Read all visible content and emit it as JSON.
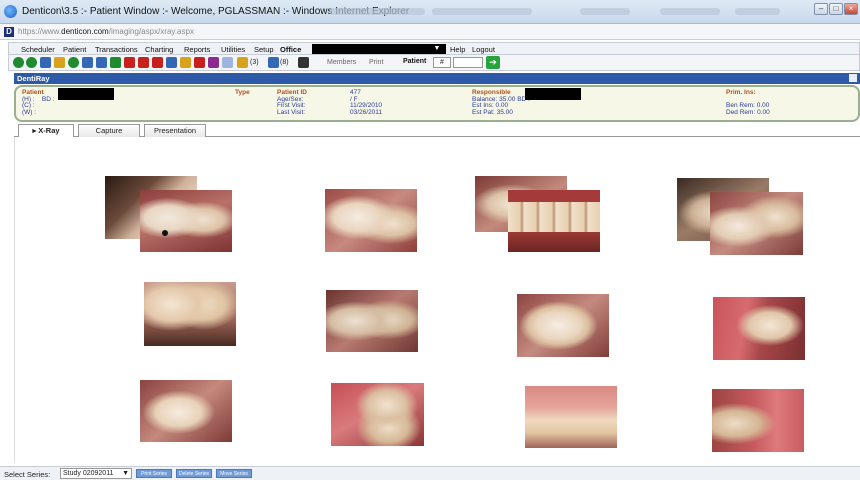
{
  "window": {
    "title": "Denticon\\3.5 :- Patient Window :- Welcome, PGLASSMAN :- Windows Internet Explorer",
    "url_prefix": "https://www.",
    "url_domain": "denticon.com",
    "url_path": "/imaging/aspx/xray.aspx"
  },
  "menu": {
    "items": [
      "Scheduler",
      "Patient",
      "Transactions",
      "Charting",
      "Reports",
      "Utilities",
      "Setup",
      "Office",
      "Help",
      "Logout"
    ]
  },
  "toolbar": {
    "count_a": "(3)",
    "count_b": "(8)",
    "members_label": "Members",
    "print_label": "Print",
    "patient_label": "Patient",
    "patient_select": "#",
    "go_label": "➔"
  },
  "module": {
    "title": "DentiRay"
  },
  "patient": {
    "patient_label": "Patient",
    "h_label": "(H) :",
    "bd_label": "BD :",
    "c_label": "(C) :",
    "w_label": "(W) :",
    "type_label": "Type",
    "patient_id_label": "Patient ID",
    "age_sex_label": "Age/Sex:",
    "first_visit_label": "First Visit:",
    "last_visit_label": "Last Visit:",
    "patient_id": "477",
    "age_sex": "/ F",
    "first_visit": "11/29/2010",
    "last_visit": "03/26/2011",
    "responsible_label": "Responsible",
    "balance_label": "Balance:",
    "balance": "35.00",
    "est_ins_label": "Est Ins:",
    "est_ins": "0.00",
    "est_pat_label": "Est Pat:",
    "est_pat": "35.00",
    "prim_ins_label": "Prim. Ins:",
    "ben_rem_label": "Ben Rem:",
    "ben_rem": "0.00",
    "ded_rem_label": "Ded Rem:",
    "ded_rem": "0.00"
  },
  "tabs": [
    {
      "label": "▸ X-Ray",
      "active": true
    },
    {
      "label": "Capture",
      "active": false
    },
    {
      "label": "Presentation",
      "active": false
    }
  ],
  "status": {
    "select_series_label": "Select Series:",
    "series_value": "Study 02092011",
    "buttons": [
      "Print Series",
      "Delete Series",
      "Move Series"
    ]
  },
  "colors": {
    "module_bar": "#2d5aa8",
    "info_border": "#9aae92",
    "label_orange": "#b0501e",
    "value_blue": "#2a3a9a"
  },
  "photos": [
    {
      "name": "intraoral-photo-1-back",
      "desc": "occlusal molar partial"
    },
    {
      "name": "intraoral-photo-1",
      "desc": "occlusal molar with dark spot"
    },
    {
      "name": "intraoral-photo-2",
      "desc": "occlusal molar"
    },
    {
      "name": "intraoral-photo-3-back",
      "desc": "occlusal partial"
    },
    {
      "name": "intraoral-photo-3",
      "desc": "anterior teeth frontal"
    },
    {
      "name": "intraoral-photo-4-back",
      "desc": "occlusal partial"
    },
    {
      "name": "intraoral-photo-4",
      "desc": "occlusal molars"
    },
    {
      "name": "intraoral-photo-5",
      "desc": "premolars buccal"
    },
    {
      "name": "intraoral-photo-6",
      "desc": "molars occlusal"
    },
    {
      "name": "intraoral-photo-7",
      "desc": "molar occlusal"
    },
    {
      "name": "intraoral-photo-8",
      "desc": "tongue and molar"
    },
    {
      "name": "intraoral-photo-9",
      "desc": "single molar occlusal"
    },
    {
      "name": "intraoral-photo-10",
      "desc": "buccal molars"
    },
    {
      "name": "intraoral-photo-11",
      "desc": "lower anterior teeth"
    },
    {
      "name": "intraoral-photo-12",
      "desc": "tongue and molars"
    }
  ]
}
